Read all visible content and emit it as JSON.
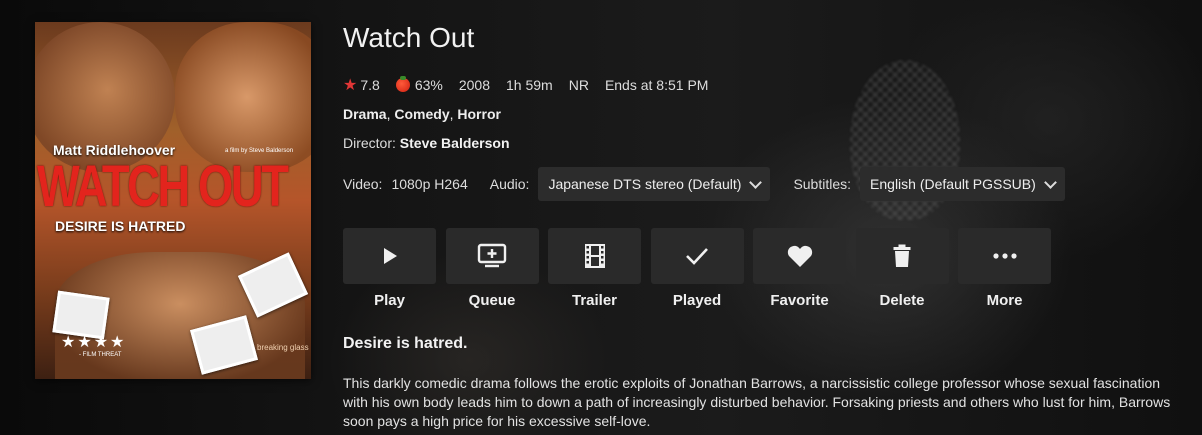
{
  "movie": {
    "title": "Watch Out",
    "rating_community": "7.8",
    "rating_critic": "63%",
    "year": "2008",
    "runtime": "1h 59m",
    "official_rating": "NR",
    "ends_at": "Ends at 8:51 PM",
    "genres": [
      "Drama",
      "Comedy",
      "Horror"
    ],
    "director_label": "Director:",
    "director": "Steve Balderson",
    "tagline": "Desire is hatred.",
    "overview": "This darkly comedic drama follows the erotic exploits of Jonathan Barrows, a narcissistic college professor whose sexual fascination with his own body leads him to down a path of increasingly disturbed behavior. Forsaking priests and others who lust for him, Barrows soon pays a high price for his excessive self-love."
  },
  "poster": {
    "actor": "Matt Riddlehoover",
    "credit": "a film by Steve Balderson",
    "title": "WATCH OUT",
    "tagline": "DESIRE IS HATRED",
    "stars": "★★★★",
    "review_source": "- FILM THREAT",
    "logo": "breaking glass"
  },
  "tracks": {
    "video_label": "Video:",
    "video_value": "1080p H264",
    "audio_label": "Audio:",
    "audio_value": "Japanese DTS stereo (Default)",
    "subtitles_label": "Subtitles:",
    "subtitles_value": "English (Default PGSSUB)"
  },
  "actions": [
    {
      "label": "Play",
      "icon": "play-icon"
    },
    {
      "label": "Queue",
      "icon": "queue-icon"
    },
    {
      "label": "Trailer",
      "icon": "film-icon"
    },
    {
      "label": "Played",
      "icon": "check-icon"
    },
    {
      "label": "Favorite",
      "icon": "heart-icon"
    },
    {
      "label": "Delete",
      "icon": "trash-icon"
    },
    {
      "label": "More",
      "icon": "more-icon"
    }
  ],
  "colors": {
    "background": "#0d0d0d",
    "button_bg": "#2a2a2a",
    "select_bg": "#2c2c2c",
    "star": "#e03636",
    "text": "#f2f2f2"
  }
}
